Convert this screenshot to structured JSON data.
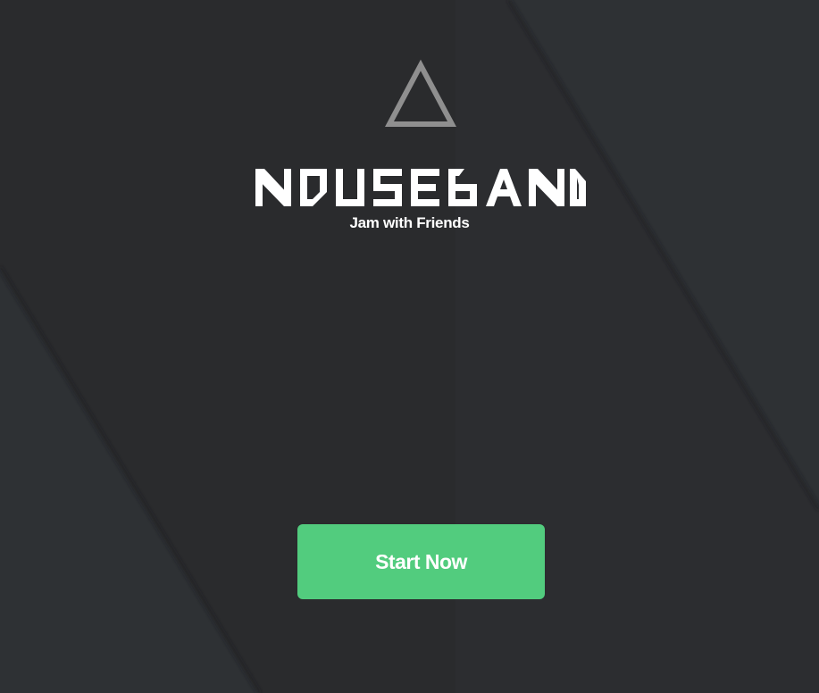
{
  "app": {
    "brand_name": "NOUSEBAND",
    "tagline": "Jam with Friends"
  },
  "actions": {
    "start_label": "Start Now"
  },
  "icons": {
    "logo": "triangle-logo-icon"
  },
  "colors": {
    "background": "#2d2f31",
    "background_dark_band": "#2a2b2d",
    "accent": "#52cc7e",
    "logo_gray": "#8f8f8f",
    "text": "#ffffff"
  }
}
